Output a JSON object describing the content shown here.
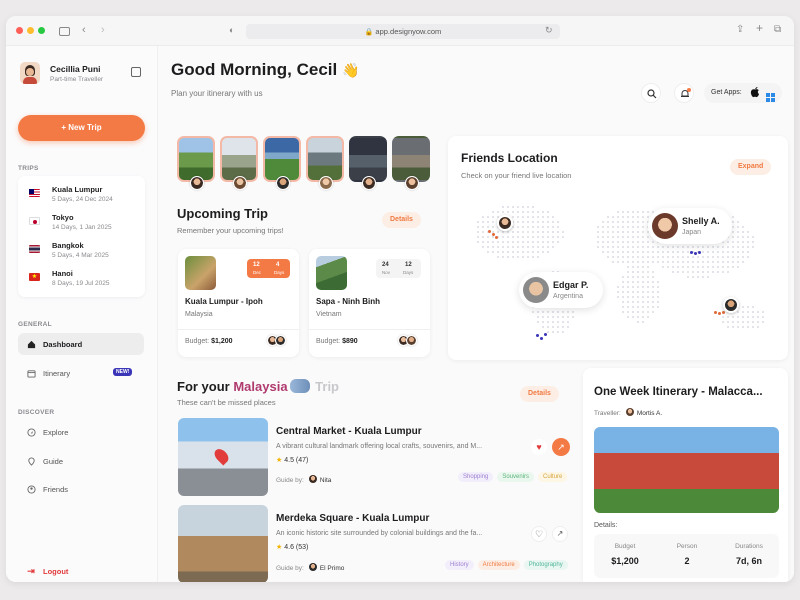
{
  "browser": {
    "url": "app.designyow.com"
  },
  "user": {
    "name": "Cecillia Puni",
    "role": "Part-time Traveller"
  },
  "sidebar": {
    "new_trip": "+ New Trip",
    "trips_label": "TRIPS",
    "trips": [
      {
        "city": "Kuala Lumpur",
        "meta": "5 Days, 24 Dec 2024",
        "flag": "MY"
      },
      {
        "city": "Tokyo",
        "meta": "14 Days, 1 Jan 2025",
        "flag": "JP"
      },
      {
        "city": "Bangkok",
        "meta": "5 Days, 4 Mar 2025",
        "flag": "TH"
      },
      {
        "city": "Hanoi",
        "meta": "8 Days, 19 Jul 2025",
        "flag": "VN"
      }
    ],
    "general_label": "GENERAL",
    "dashboard": "Dashboard",
    "itinerary": "Itinerary",
    "new_badge": "NEW!",
    "discover_label": "DISCOVER",
    "explore": "Explore",
    "guide": "Guide",
    "friends": "Friends",
    "logout": "Logout"
  },
  "header": {
    "greeting": "Good Morning, Cecil",
    "emoji": "👋",
    "subtitle": "Plan your itinerary with us",
    "get_apps": "Get Apps:"
  },
  "upcoming": {
    "title": "Upcoming Trip",
    "subtitle": "Remember your upcoming trips!",
    "details": "Details",
    "trips": [
      {
        "route": "Kuala Lumpur - Ipoh",
        "country": "Malaysia",
        "budget_label": "Budget:",
        "budget": "$1,200",
        "d1": "12",
        "d1s": "Dec",
        "d2": "4",
        "d2s": "Days"
      },
      {
        "route": "Sapa - Ninh Binh",
        "country": "Vietnam",
        "budget_label": "Budget:",
        "budget": "$890",
        "d1": "24",
        "d1s": "Nov",
        "d2": "12",
        "d2s": "Days"
      }
    ]
  },
  "friends": {
    "title": "Friends Location",
    "subtitle": "Check on your friend live location",
    "expand": "Expand",
    "people": [
      {
        "name": "Shelly A.",
        "country": "Japan"
      },
      {
        "name": "Edgar P.",
        "country": "Argentina"
      }
    ]
  },
  "malaysia": {
    "title_prefix": "For your ",
    "title_country": "Malaysia",
    "title_suffix": " Trip",
    "subtitle": "These can't be missed places",
    "details": "Details",
    "places": [
      {
        "name": "Central Market - Kuala Lumpur",
        "desc": "A vibrant cultural landmark offering local crafts, souvenirs, and M...",
        "rating": "4.5",
        "count": "(47)",
        "guide_label": "Guide by:",
        "guide": "Nita",
        "tags": [
          "Shopping",
          "Souvenirs",
          "Culture"
        ]
      },
      {
        "name": "Merdeka Square - Kuala Lumpur",
        "desc": "An iconic historic site surrounded by colonial buildings and the fa...",
        "rating": "4.6",
        "count": "(53)",
        "guide_label": "Guide by:",
        "guide": "El Primo",
        "tags": [
          "History",
          "Architecture",
          "Photography"
        ]
      }
    ]
  },
  "itinerary": {
    "title": "One Week Itinerary - Malacca...",
    "traveler_label": "Traveller:",
    "traveler": "Mortis A.",
    "details_label": "Details:",
    "stats": [
      {
        "label": "Budget",
        "value": "$1,200"
      },
      {
        "label": "Person",
        "value": "2"
      },
      {
        "label": "Durations",
        "value": "7d, 6n"
      }
    ]
  },
  "colors": {
    "accent": "#f47a45",
    "accent_light": "#fdeee5",
    "badge": "#3b35b8"
  }
}
